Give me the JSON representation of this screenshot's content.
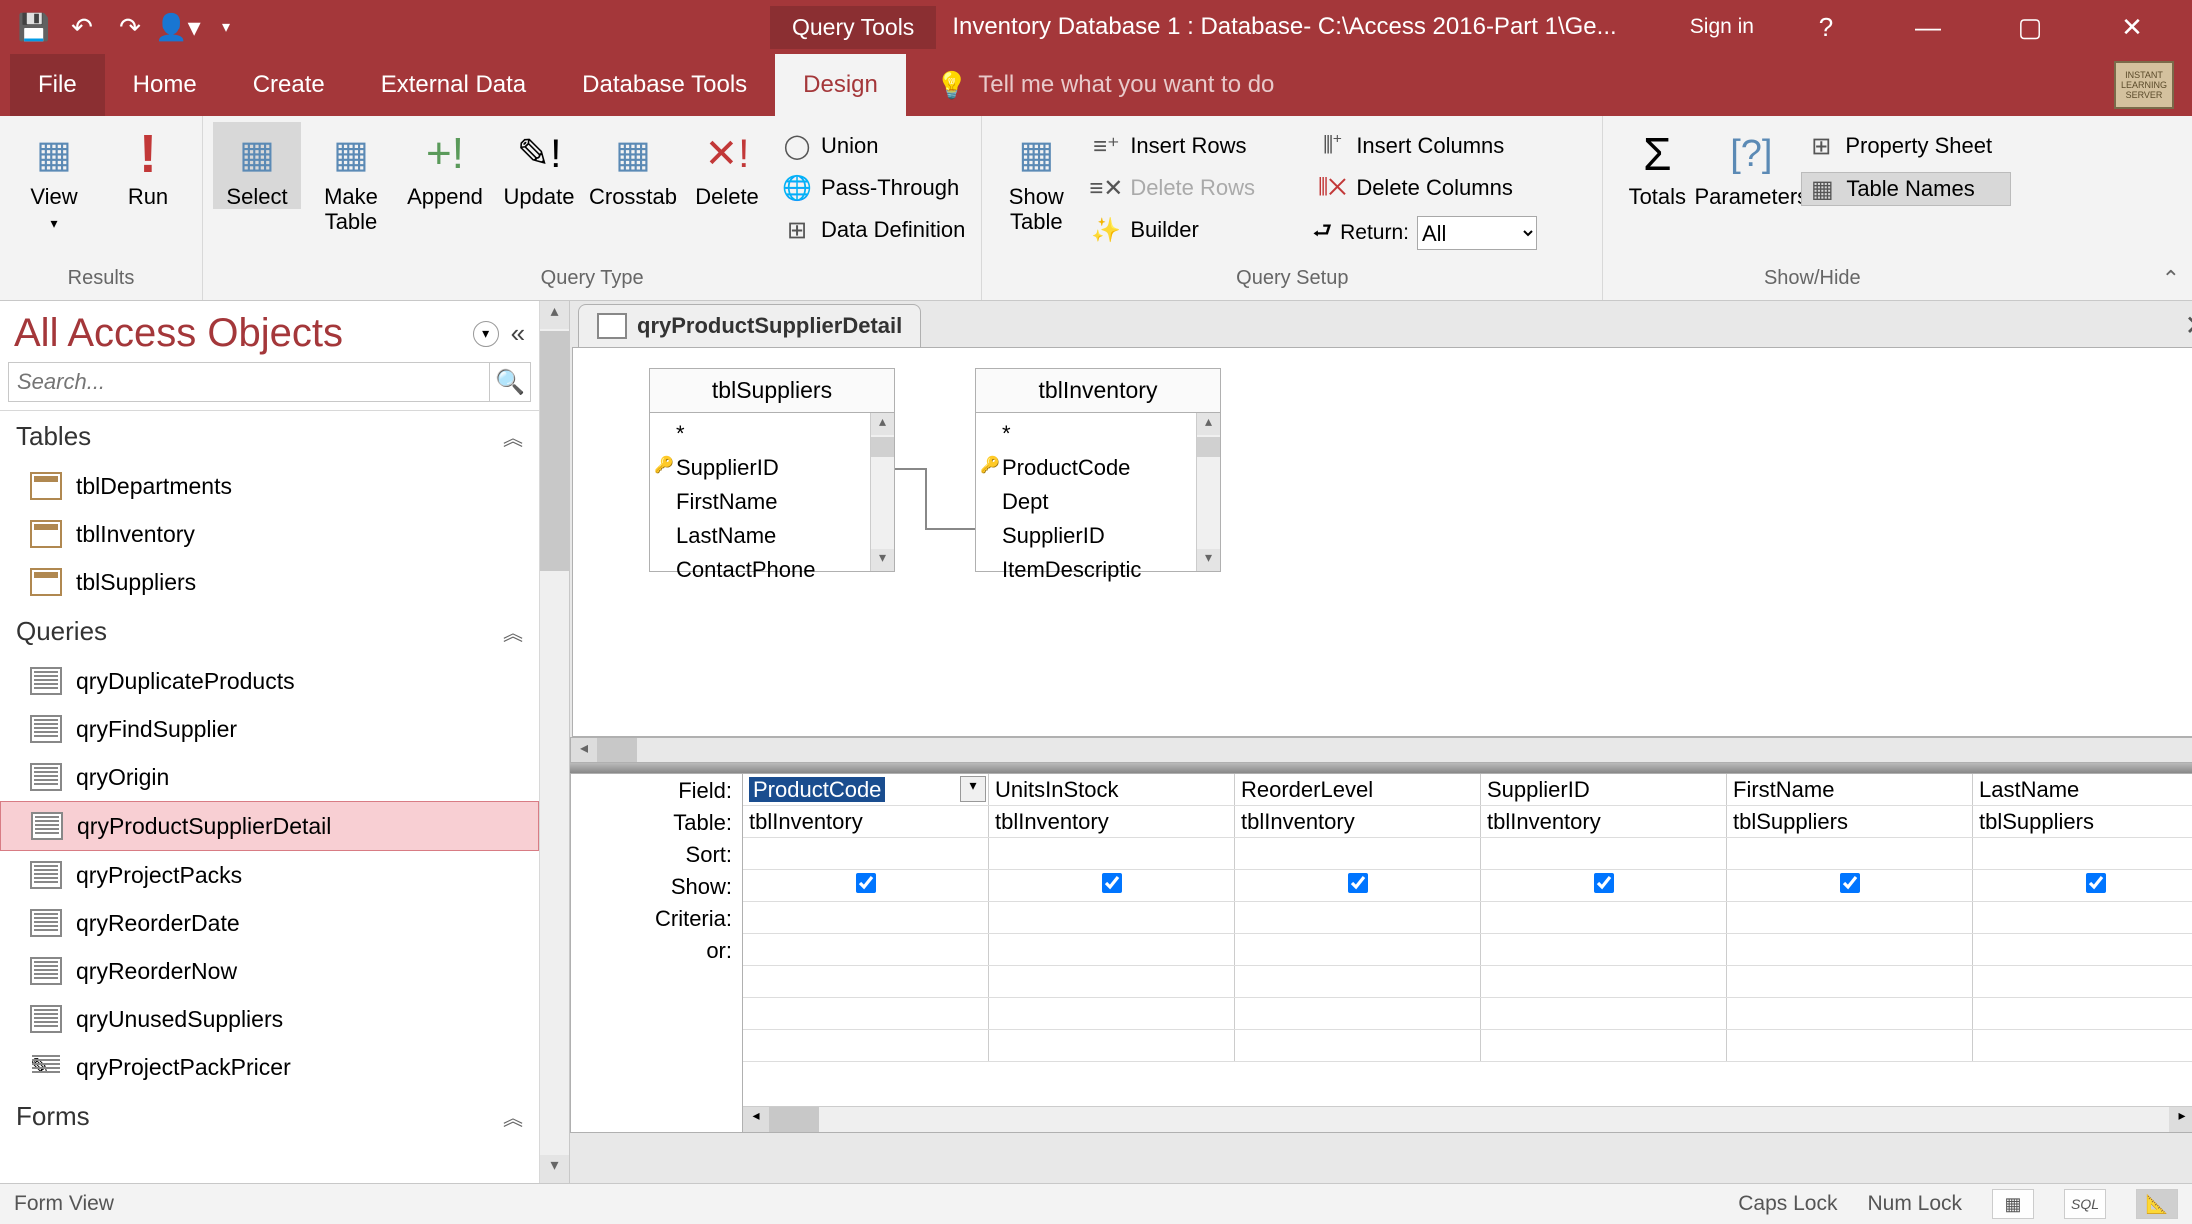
{
  "titlebar": {
    "context_tab": "Query Tools",
    "title": "Inventory Database 1 : Database- C:\\Access 2016-Part 1\\Ge...",
    "signin": "Sign in"
  },
  "tabs": {
    "file": "File",
    "home": "Home",
    "create": "Create",
    "external": "External Data",
    "dbtools": "Database Tools",
    "design": "Design",
    "tellme": "Tell me what you want to do"
  },
  "ribbon": {
    "results": {
      "view": "View",
      "run": "Run",
      "label": "Results"
    },
    "querytype": {
      "select": "Select",
      "maketable": "Make\nTable",
      "append": "Append",
      "update": "Update",
      "crosstab": "Crosstab",
      "delete": "Delete",
      "union": "Union",
      "passthrough": "Pass-Through",
      "datadef": "Data Definition",
      "label": "Query Type"
    },
    "setup": {
      "showtable": "Show\nTable",
      "insertrows": "Insert Rows",
      "deleterows": "Delete Rows",
      "builder": "Builder",
      "insertcols": "Insert Columns",
      "deletecols": "Delete Columns",
      "return": "Return:",
      "return_val": "All",
      "label": "Query Setup"
    },
    "showhide": {
      "totals": "Totals",
      "parameters": "Parameters",
      "propsheet": "Property Sheet",
      "tablenames": "Table Names",
      "label": "Show/Hide"
    }
  },
  "nav": {
    "title": "All Access Objects",
    "search_placeholder": "Search...",
    "cat_tables": "Tables",
    "tables": [
      "tblDepartments",
      "tblInventory",
      "tblSuppliers"
    ],
    "cat_queries": "Queries",
    "queries": [
      "qryDuplicateProducts",
      "qryFindSupplier",
      "qryOrigin",
      "qryProductSupplierDetail",
      "qryProjectPacks",
      "qryReorderDate",
      "qryReorderNow",
      "qryUnusedSuppliers",
      "qryProjectPackPricer"
    ],
    "cat_forms": "Forms"
  },
  "doc": {
    "tab": "qryProductSupplierDetail",
    "table1": {
      "name": "tblSuppliers",
      "fields": [
        "*",
        "SupplierID",
        "FirstName",
        "LastName",
        "ContactPhone"
      ],
      "pk": "SupplierID"
    },
    "table2": {
      "name": "tblInventory",
      "fields": [
        "*",
        "ProductCode",
        "Dept",
        "SupplierID",
        "ItemDescriptic"
      ],
      "pk": "ProductCode"
    }
  },
  "qbe": {
    "labels": {
      "field": "Field:",
      "table": "Table:",
      "sort": "Sort:",
      "show": "Show:",
      "criteria": "Criteria:",
      "or": "or:"
    },
    "cols": [
      {
        "field": "ProductCode",
        "table": "tblInventory",
        "show": true,
        "selected": true
      },
      {
        "field": "UnitsInStock",
        "table": "tblInventory",
        "show": true
      },
      {
        "field": "ReorderLevel",
        "table": "tblInventory",
        "show": true
      },
      {
        "field": "SupplierID",
        "table": "tblInventory",
        "show": true
      },
      {
        "field": "FirstName",
        "table": "tblSuppliers",
        "show": true
      },
      {
        "field": "LastName",
        "table": "tblSuppliers",
        "show": true
      }
    ]
  },
  "status": {
    "left": "Form View",
    "caps": "Caps Lock",
    "num": "Num Lock"
  }
}
